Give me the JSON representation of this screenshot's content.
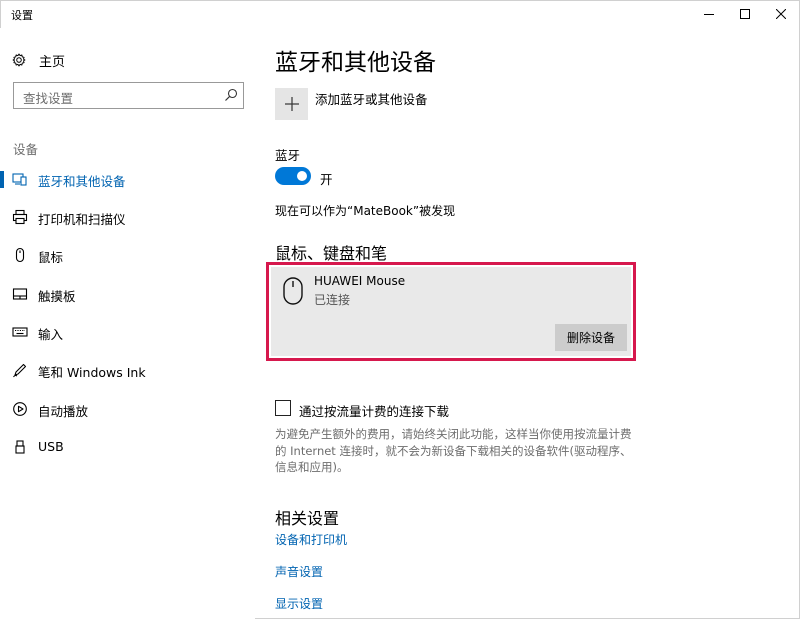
{
  "window": {
    "title": "设置",
    "minimize_icon": "minimize-icon",
    "maximize_icon": "maximize-icon",
    "close_icon": "close-icon"
  },
  "sidebar": {
    "home_label": "主页",
    "home_icon": "gear-icon",
    "search_placeholder": "查找设置",
    "search_icon": "search-icon",
    "section_label": "设备",
    "items": [
      {
        "label": "蓝牙和其他设备",
        "icon": "bluetooth-devices-icon",
        "active": true
      },
      {
        "label": "打印机和扫描仪",
        "icon": "printer-icon",
        "active": false
      },
      {
        "label": "鼠标",
        "icon": "mouse-icon",
        "active": false
      },
      {
        "label": "触摸板",
        "icon": "touchpad-icon",
        "active": false
      },
      {
        "label": "输入",
        "icon": "keyboard-icon",
        "active": false
      },
      {
        "label": "笔和 Windows Ink",
        "icon": "pen-icon",
        "active": false
      },
      {
        "label": "自动播放",
        "icon": "autoplay-icon",
        "active": false
      },
      {
        "label": "USB",
        "icon": "usb-icon",
        "active": false
      }
    ]
  },
  "main": {
    "title": "蓝牙和其他设备",
    "add_device_label": "添加蓝牙或其他设备",
    "bluetooth": {
      "label": "蓝牙",
      "state": "开",
      "on": true
    },
    "discoverable_text": "现在可以作为“MateBook”被发现",
    "mouse_section_title": "鼠标、键盘和笔",
    "device": {
      "name": "HUAWEI Mouse",
      "status": "已连接",
      "remove_label": "删除设备"
    },
    "metered": {
      "checkbox_label": "通过按流量计费的连接下载",
      "checked": false,
      "description": "为避免产生额外的费用，请始终关闭此功能，这样当你使用按流量计费的 Internet 连接时，就不会为新设备下载相关的设备软件(驱动程序、信息和应用)。"
    },
    "related": {
      "title": "相关设置",
      "links": [
        "设备和打印机",
        "声音设置",
        "显示设置"
      ]
    }
  },
  "colors": {
    "accent": "#0078d7",
    "link": "#0063b1",
    "highlight": "#d6184d"
  }
}
